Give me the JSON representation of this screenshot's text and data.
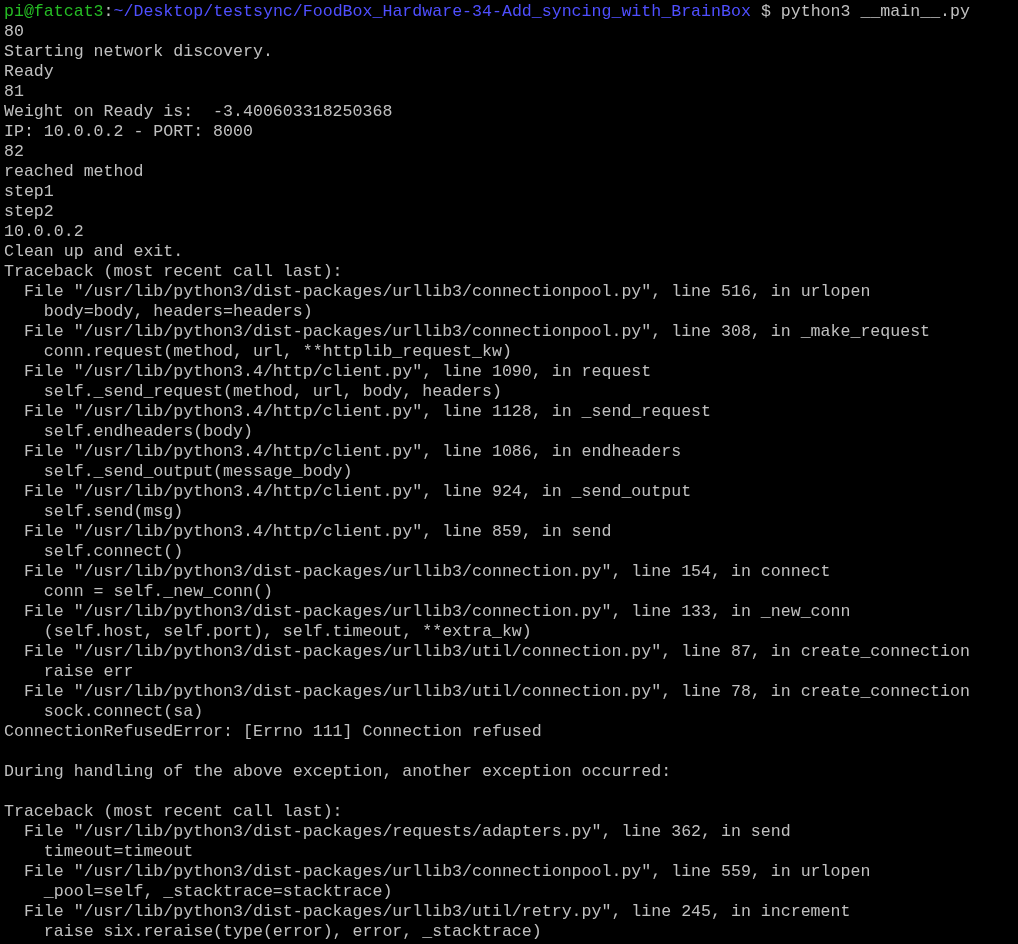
{
  "prompt": {
    "user_host": "pi@fatcat3",
    "separator": ":",
    "path": "~/Desktop/testsync/FoodBox_Hardware-34-Add_syncing_with_BrainBox",
    "command": "$ python3 __main__.py"
  },
  "lines": [
    {
      "kind": "text",
      "text": "80"
    },
    {
      "kind": "text",
      "text": "Starting network discovery."
    },
    {
      "kind": "text",
      "text": "Ready"
    },
    {
      "kind": "text",
      "text": "81"
    },
    {
      "kind": "text",
      "text": "Weight on Ready is:  -3.400603318250368"
    },
    {
      "kind": "text",
      "text": "IP: 10.0.0.2 - PORT: 8000"
    },
    {
      "kind": "text",
      "text": "82"
    },
    {
      "kind": "text",
      "text": "reached method"
    },
    {
      "kind": "text",
      "text": "step1"
    },
    {
      "kind": "text",
      "text": "step2"
    },
    {
      "kind": "text",
      "text": "10.0.0.2"
    },
    {
      "kind": "text",
      "text": "Clean up and exit."
    },
    {
      "kind": "text",
      "text": "Traceback (most recent call last):"
    },
    {
      "kind": "text",
      "text": "  File \"/usr/lib/python3/dist-packages/urllib3/connectionpool.py\", line 516, in urlopen"
    },
    {
      "kind": "text",
      "text": "    body=body, headers=headers)"
    },
    {
      "kind": "text",
      "text": "  File \"/usr/lib/python3/dist-packages/urllib3/connectionpool.py\", line 308, in _make_request"
    },
    {
      "kind": "text",
      "text": "    conn.request(method, url, **httplib_request_kw)"
    },
    {
      "kind": "text",
      "text": "  File \"/usr/lib/python3.4/http/client.py\", line 1090, in request"
    },
    {
      "kind": "text",
      "text": "    self._send_request(method, url, body, headers)"
    },
    {
      "kind": "text",
      "text": "  File \"/usr/lib/python3.4/http/client.py\", line 1128, in _send_request"
    },
    {
      "kind": "text",
      "text": "    self.endheaders(body)"
    },
    {
      "kind": "text",
      "text": "  File \"/usr/lib/python3.4/http/client.py\", line 1086, in endheaders"
    },
    {
      "kind": "text",
      "text": "    self._send_output(message_body)"
    },
    {
      "kind": "text",
      "text": "  File \"/usr/lib/python3.4/http/client.py\", line 924, in _send_output"
    },
    {
      "kind": "text",
      "text": "    self.send(msg)"
    },
    {
      "kind": "text",
      "text": "  File \"/usr/lib/python3.4/http/client.py\", line 859, in send"
    },
    {
      "kind": "text",
      "text": "    self.connect()"
    },
    {
      "kind": "text",
      "text": "  File \"/usr/lib/python3/dist-packages/urllib3/connection.py\", line 154, in connect"
    },
    {
      "kind": "text",
      "text": "    conn = self._new_conn()"
    },
    {
      "kind": "text",
      "text": "  File \"/usr/lib/python3/dist-packages/urllib3/connection.py\", line 133, in _new_conn"
    },
    {
      "kind": "text",
      "text": "    (self.host, self.port), self.timeout, **extra_kw)"
    },
    {
      "kind": "text",
      "text": "  File \"/usr/lib/python3/dist-packages/urllib3/util/connection.py\", line 87, in create_connection"
    },
    {
      "kind": "text",
      "text": "    raise err"
    },
    {
      "kind": "text",
      "text": "  File \"/usr/lib/python3/dist-packages/urllib3/util/connection.py\", line 78, in create_connection"
    },
    {
      "kind": "text",
      "text": "    sock.connect(sa)"
    },
    {
      "kind": "text",
      "text": "ConnectionRefusedError: [Errno 111] Connection refused"
    },
    {
      "kind": "blank"
    },
    {
      "kind": "text",
      "text": "During handling of the above exception, another exception occurred:"
    },
    {
      "kind": "blank"
    },
    {
      "kind": "text",
      "text": "Traceback (most recent call last):"
    },
    {
      "kind": "text",
      "text": "  File \"/usr/lib/python3/dist-packages/requests/adapters.py\", line 362, in send"
    },
    {
      "kind": "text",
      "text": "    timeout=timeout"
    },
    {
      "kind": "text",
      "text": "  File \"/usr/lib/python3/dist-packages/urllib3/connectionpool.py\", line 559, in urlopen"
    },
    {
      "kind": "text",
      "text": "    _pool=self, _stacktrace=stacktrace)"
    },
    {
      "kind": "text",
      "text": "  File \"/usr/lib/python3/dist-packages/urllib3/util/retry.py\", line 245, in increment"
    },
    {
      "kind": "text",
      "text": "    raise six.reraise(type(error), error, _stacktrace)"
    }
  ]
}
